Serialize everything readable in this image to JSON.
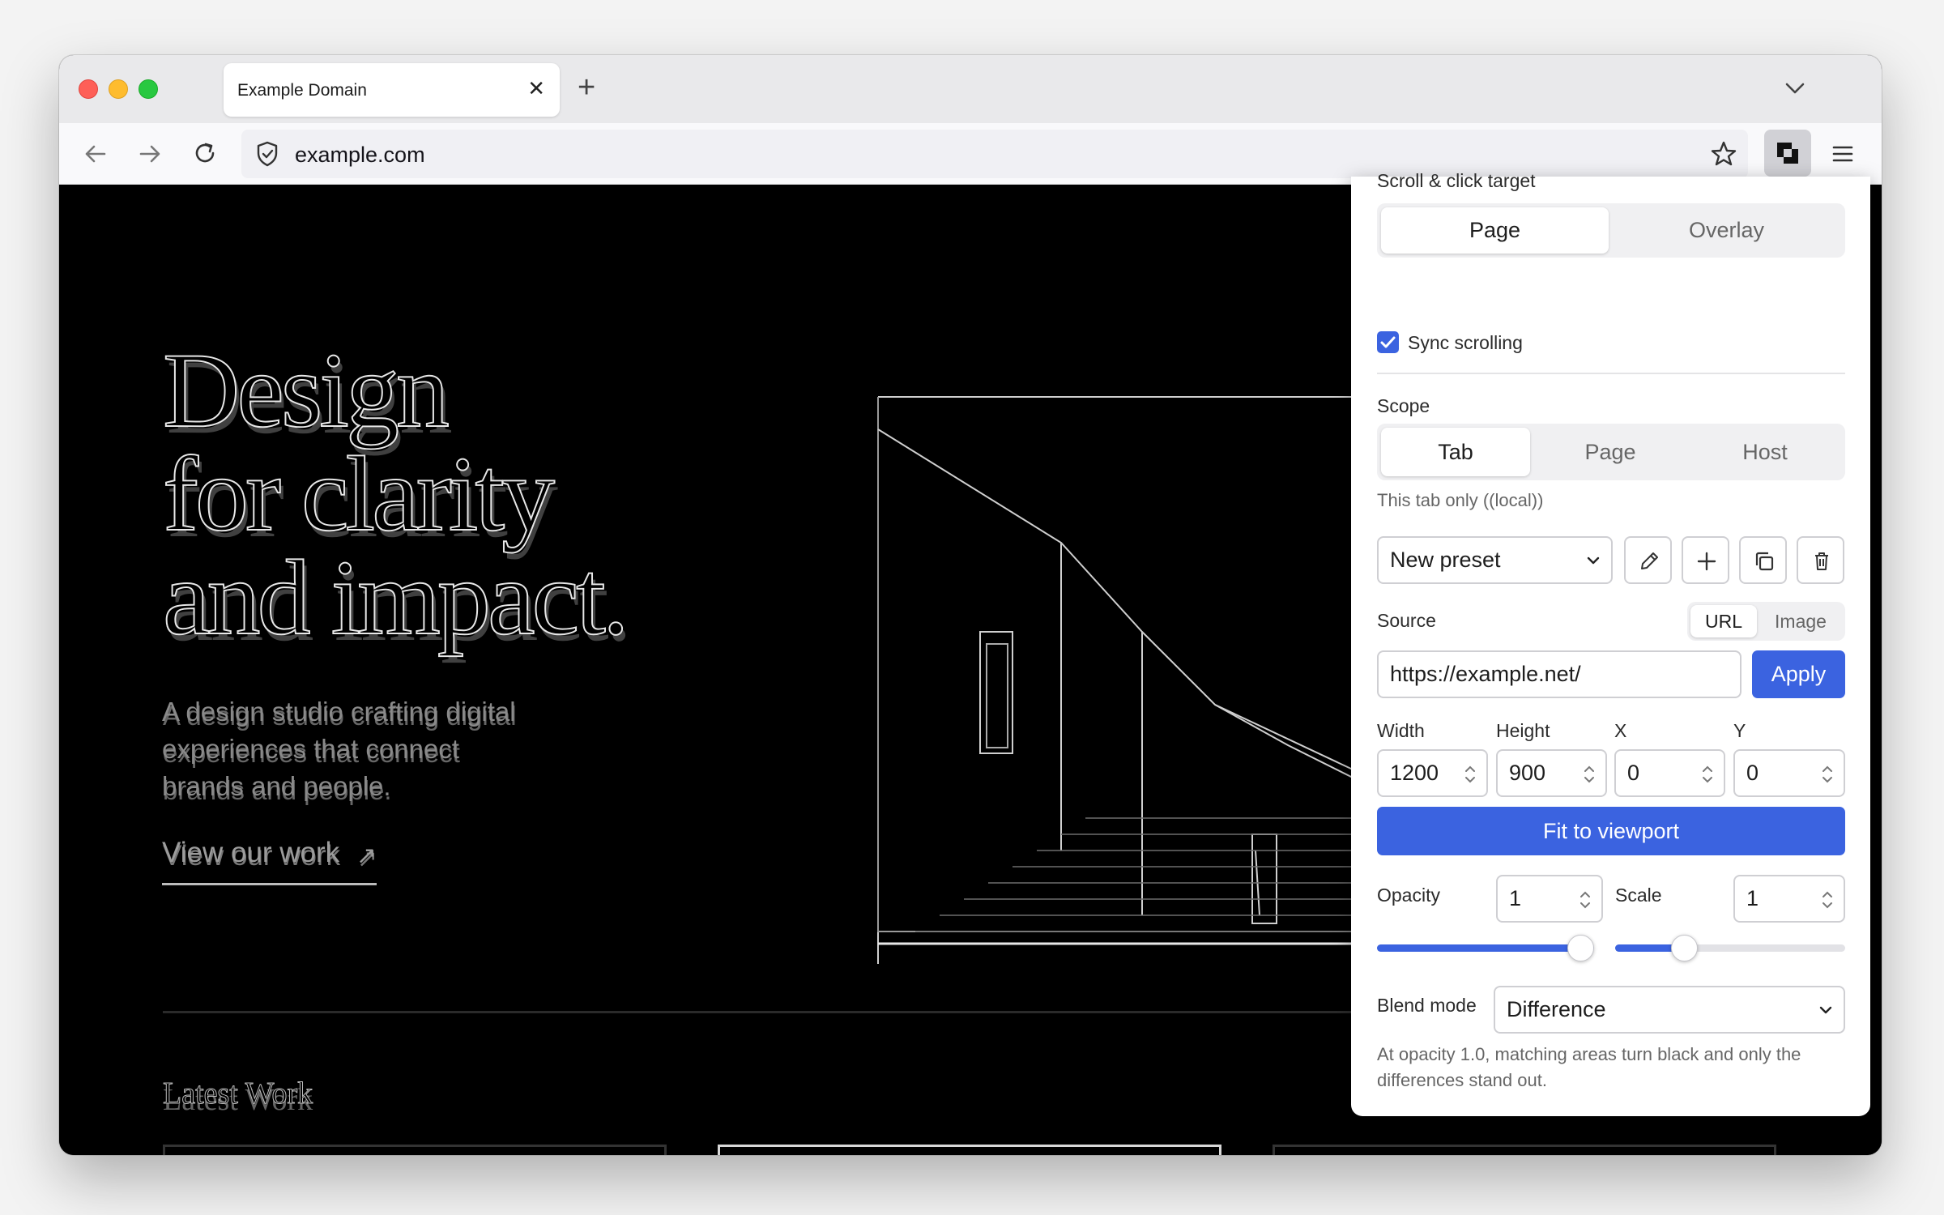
{
  "browser": {
    "tab_title": "Example Domain",
    "url": "example.com"
  },
  "site": {
    "hero_title": "Design\nfor clarity\nand impact.",
    "hero_subtitle": "A design studio crafting digital experiences that connect brands and people.",
    "hero_link": "View our work",
    "section_title": "Latest Work"
  },
  "overlay": {
    "scroll_target_label": "Scroll & click target",
    "scroll_target_options": [
      "Page",
      "Overlay"
    ],
    "scroll_target_selected": "Page",
    "sync_scrolling_label": "Sync scrolling",
    "sync_scrolling_checked": true,
    "scope_label": "Scope",
    "scope_options": [
      "Tab",
      "Page",
      "Host"
    ],
    "scope_selected": "Tab",
    "scope_note": "This tab only ((local))",
    "preset_value": "New preset",
    "source_label": "Source",
    "source_options": [
      "URL",
      "Image"
    ],
    "source_selected": "URL",
    "source_url": "https://example.net/",
    "apply_label": "Apply",
    "width_label": "Width",
    "width_value": "1200",
    "height_label": "Height",
    "height_value": "900",
    "x_label": "X",
    "x_value": "0",
    "y_label": "Y",
    "y_value": "0",
    "fit_label": "Fit to viewport",
    "opacity_label": "Opacity",
    "opacity_value": "1",
    "scale_label": "Scale",
    "scale_value": "1",
    "opacity_slider_fraction": 1.0,
    "scale_slider_fraction": 0.3,
    "blend_label": "Blend mode",
    "blend_value": "Difference",
    "blend_note": "At opacity 1.0, matching areas turn black and only the differences stand out.",
    "accent_color": "#3b63e0"
  }
}
